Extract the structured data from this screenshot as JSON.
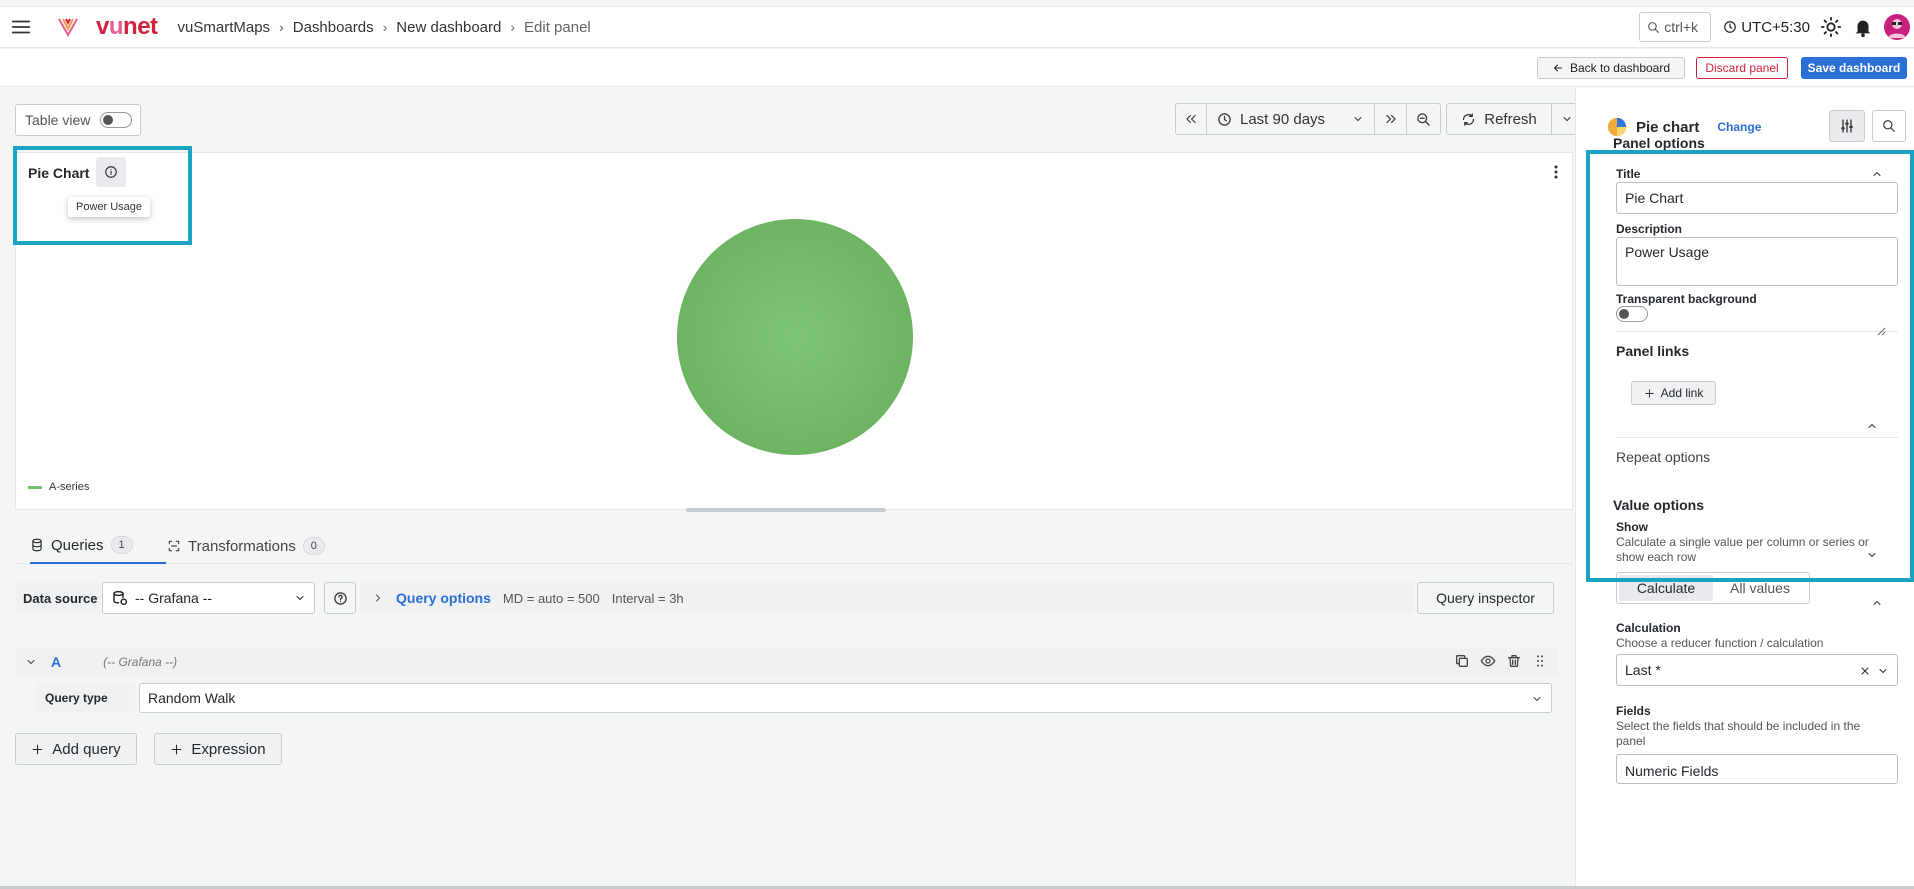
{
  "brand": {
    "name_left": "v",
    "name_u": "u",
    "name_right": "net"
  },
  "breadcrumb": [
    "vuSmartMaps",
    "Dashboards",
    "New dashboard",
    "Edit panel"
  ],
  "topbar": {
    "search_shortcut": "ctrl+k",
    "timezone": "UTC+5:30"
  },
  "actions": {
    "back": "Back to dashboard",
    "discard": "Discard panel",
    "save": "Save dashboard"
  },
  "toolbar": {
    "table_view": "Table view",
    "time_range": "Last 90 days",
    "refresh": "Refresh"
  },
  "panel": {
    "title": "Pie Chart",
    "tooltip": "Power Usage",
    "legend": "A-series"
  },
  "chart_data": {
    "type": "pie",
    "series": [
      {
        "name": "A-series",
        "values": [
          100
        ]
      }
    ],
    "colors": [
      "#73bf69"
    ]
  },
  "tabs": {
    "queries": "Queries",
    "queries_count": "1",
    "transformations": "Transformations",
    "transformations_count": "0"
  },
  "datasource": {
    "label": "Data source",
    "value": "-- Grafana --",
    "query_options": "Query options",
    "md": "MD = auto = 500",
    "interval": "Interval = 3h",
    "inspector": "Query inspector"
  },
  "query": {
    "letter": "A",
    "ds": "(-- Grafana --)",
    "type_label": "Query type",
    "type_value": "Random Walk",
    "add_query": "Add query",
    "expression": "Expression"
  },
  "side": {
    "viz_name": "Pie chart",
    "change": "Change",
    "panel_options": "Panel options",
    "title_label": "Title",
    "title_value": "Pie Chart",
    "desc_label": "Description",
    "desc_value": "Power Usage",
    "transparent_label": "Transparent background",
    "panel_links": "Panel links",
    "add_link": "Add link",
    "repeat_options": "Repeat options",
    "value_options": "Value options",
    "show_label": "Show",
    "show_desc": "Calculate a single value per column or series or show each row",
    "show_calc": "Calculate",
    "show_all": "All values",
    "calc_label": "Calculation",
    "calc_desc": "Choose a reducer function / calculation",
    "calc_value": "Last *",
    "fields_label": "Fields",
    "fields_desc": "Select the fields that should be included in the panel",
    "fields_value": "Numeric Fields"
  },
  "colors": {
    "accent": "#2b6fd6",
    "brand": "#d2233c",
    "highlight": "#1aa3c2",
    "series": "#73bf69"
  }
}
